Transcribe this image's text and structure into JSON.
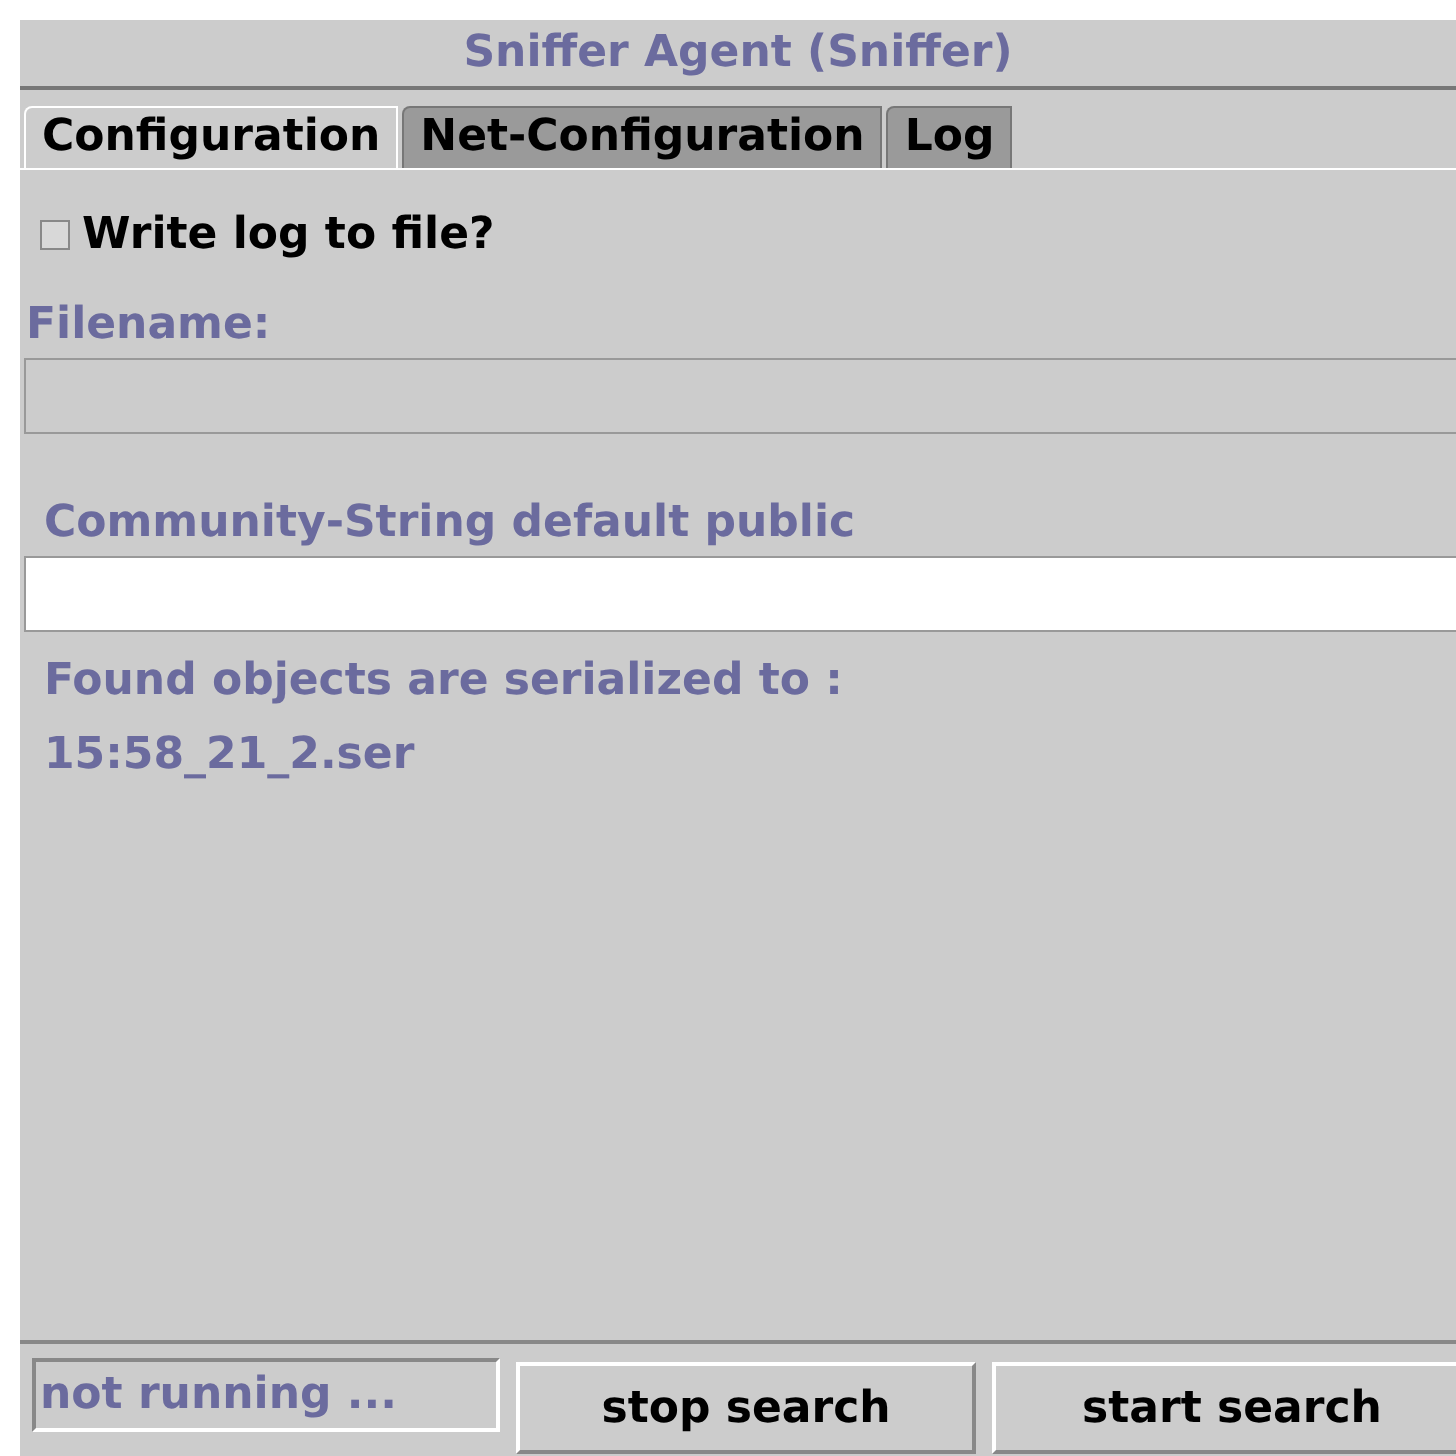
{
  "window": {
    "title": "Sniffer Agent (Sniffer)"
  },
  "tabs": [
    {
      "label": "Configuration",
      "selected": true
    },
    {
      "label": "Net-Configuration",
      "selected": false
    },
    {
      "label": "Log",
      "selected": false
    }
  ],
  "log_checkbox": {
    "label": "Write log to file?",
    "checked": false
  },
  "filename": {
    "label": "Filename:",
    "disabled": true
  },
  "community": {
    "label": "Community-String default public"
  },
  "serialization": {
    "label": "Found objects are serialized to :",
    "value": "15:58_21_2.ser"
  },
  "status": {
    "value": "not running ..."
  },
  "buttons": [
    "stop search",
    "start search"
  ]
}
